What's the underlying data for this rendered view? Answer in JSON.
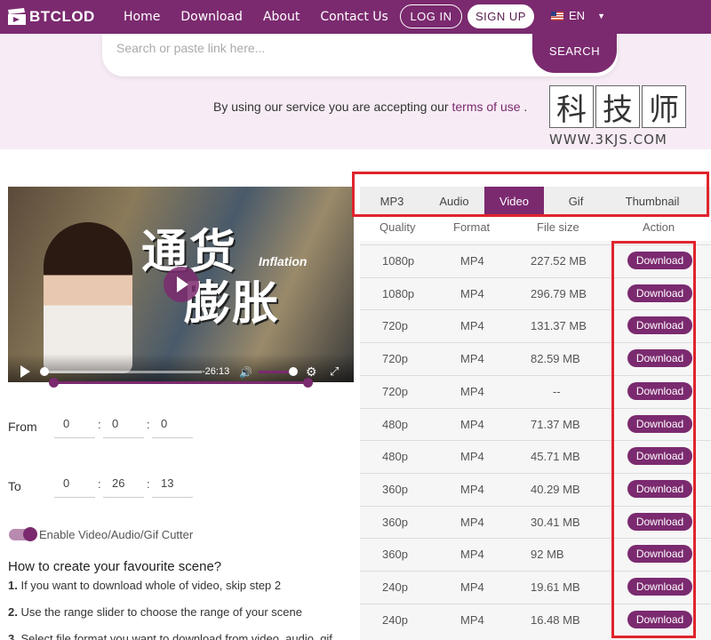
{
  "header": {
    "logo_text": "BTCLOD",
    "nav": [
      "Home",
      "Download",
      "About",
      "Contact Us"
    ],
    "login_label": "LOG IN",
    "signup_label": "SIGN UP",
    "lang": "EN"
  },
  "search": {
    "placeholder": "Search or paste link here...",
    "button_label": "SEARCH"
  },
  "terms": {
    "prefix": "By using our service you are accepting our",
    "link": "terms of use",
    "suffix": "."
  },
  "watermark": {
    "chars": [
      "科",
      "技",
      "师"
    ],
    "url": "WWW.3KJS.COM"
  },
  "video": {
    "title_cn_1": "通货",
    "title_cn_2": "膨胀",
    "title_en": "Inflation",
    "time": "-26:13"
  },
  "cutter": {
    "from_label": "From",
    "to_label": "To",
    "from": [
      "0",
      "0",
      "0"
    ],
    "to": [
      "0",
      "26",
      "13"
    ],
    "toggle_label": "Enable Video/Audio/Gif Cutter"
  },
  "howto": {
    "title": "How to create your favourite scene?",
    "steps": [
      {
        "num": "1.",
        "text": " If you want to download whole of video, skip step 2"
      },
      {
        "num": "2.",
        "text": " Use the range slider to choose the range of your scene"
      },
      {
        "num": "3.",
        "text": " Select file format you want to download from video, audio, gif"
      }
    ]
  },
  "tabs": [
    "MP3",
    "Audio",
    "Video",
    "Gif",
    "Thumbnail"
  ],
  "active_tab": "Video",
  "table": {
    "headers": [
      "Quality",
      "Format",
      "File size",
      "Action"
    ],
    "rows": [
      {
        "quality": "1080p",
        "format": "MP4",
        "size": "227.52 MB",
        "action": "Download"
      },
      {
        "quality": "1080p",
        "format": "MP4",
        "size": "296.79 MB",
        "action": "Download"
      },
      {
        "quality": "720p",
        "format": "MP4",
        "size": "131.37 MB",
        "action": "Download"
      },
      {
        "quality": "720p",
        "format": "MP4",
        "size": "82.59 MB",
        "action": "Download"
      },
      {
        "quality": "720p",
        "format": "MP4",
        "size": "--",
        "action": "Download"
      },
      {
        "quality": "480p",
        "format": "MP4",
        "size": "71.37 MB",
        "action": "Download"
      },
      {
        "quality": "480p",
        "format": "MP4",
        "size": "45.71 MB",
        "action": "Download"
      },
      {
        "quality": "360p",
        "format": "MP4",
        "size": "40.29 MB",
        "action": "Download"
      },
      {
        "quality": "360p",
        "format": "MP4",
        "size": "30.41 MB",
        "action": "Download"
      },
      {
        "quality": "360p",
        "format": "MP4",
        "size": "92 MB",
        "action": "Download"
      },
      {
        "quality": "240p",
        "format": "MP4",
        "size": "19.61 MB",
        "action": "Download"
      },
      {
        "quality": "240p",
        "format": "MP4",
        "size": "16.48 MB",
        "action": "Download"
      }
    ]
  },
  "colors": {
    "brand": "#7b2a6f",
    "highlight": "#e0242c"
  }
}
